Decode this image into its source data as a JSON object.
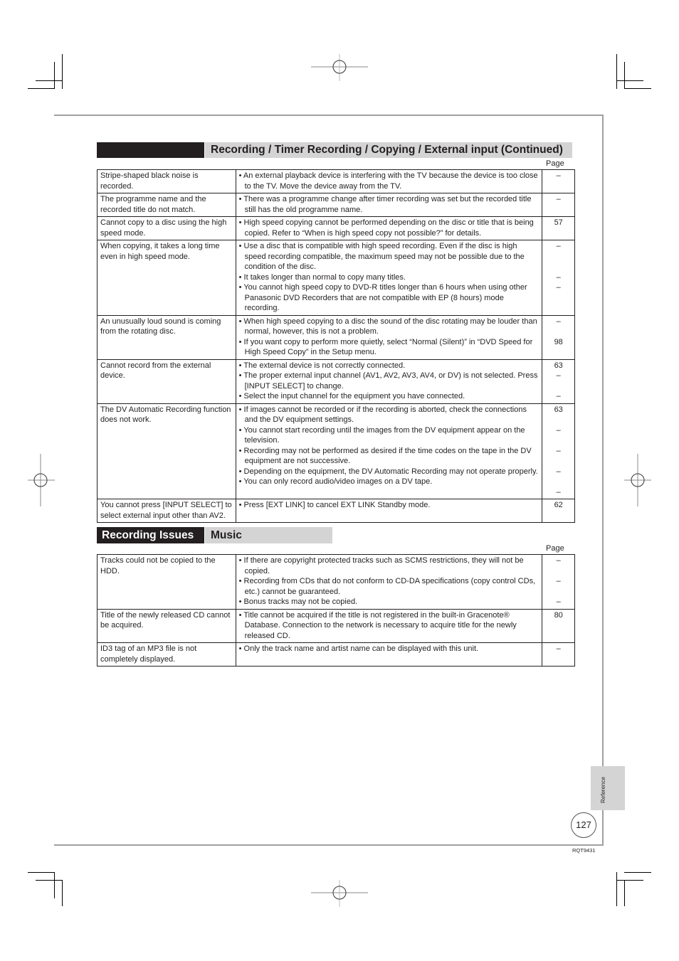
{
  "section1": {
    "title": "Recording / Timer Recording / Copying / External input (Continued)",
    "page_header": "Page",
    "rows": [
      {
        "symptom": "Stripe-shaped black noise is recorded.",
        "remedies": [
          {
            "text": "An external playback device is interfering with the TV because the device is too close to the TV. Move the device away from the TV.",
            "page": "–",
            "lines": 2
          }
        ]
      },
      {
        "symptom": "The programme name and the recorded title do not match.",
        "remedies": [
          {
            "text": "There was a programme change after timer recording was set but the recorded title still has the old programme name.",
            "page": "–",
            "lines": 2
          }
        ]
      },
      {
        "symptom": "Cannot copy to a disc using the high speed mode.",
        "remedies": [
          {
            "text": "High speed copying cannot be performed depending on the disc or title that is being copied. Refer to “When is high speed copy not possible?” for details.",
            "page": "57",
            "lines": 2
          }
        ]
      },
      {
        "symptom": "When copying, it takes a long time even in high speed mode.",
        "remedies": [
          {
            "text": "Use a disc that is compatible with high speed recording. Even if the disc is high speed recording compatible, the maximum speed may not be possible due to the condition of the disc.",
            "page": "–",
            "lines": 3
          },
          {
            "text": "It takes longer than normal to copy many titles.",
            "page": "–",
            "lines": 1
          },
          {
            "text": "You cannot high speed copy to DVD-R titles longer than 6 hours when using other Panasonic DVD Recorders that are not compatible with EP (8 hours) mode recording.",
            "page": "–",
            "lines": 3
          }
        ]
      },
      {
        "symptom": "An unusually loud sound is coming from the rotating disc.",
        "remedies": [
          {
            "text": "When high speed copying to a disc the sound of the disc rotating may be louder than normal, however, this is not a problem.",
            "page": "–",
            "lines": 2
          },
          {
            "text": "If you want copy to perform more quietly, select “Normal (Silent)” in “DVD Speed for High Speed Copy” in the Setup menu.",
            "page": "98",
            "lines": 2
          }
        ]
      },
      {
        "symptom": "Cannot record from the external device.",
        "remedies": [
          {
            "text": "The external device is not correctly connected.",
            "page": "63",
            "lines": 1
          },
          {
            "text": "The proper external input channel (AV1, AV2, AV3, AV4, or DV) is not selected. Press [INPUT SELECT] to change.",
            "page": "–",
            "lines": 2
          },
          {
            "text": "Select the input channel for the equipment you have connected.",
            "page": "–",
            "lines": 1
          }
        ]
      },
      {
        "symptom": "The DV Automatic Recording function does not work.",
        "remedies": [
          {
            "text": "If images cannot be recorded or if the recording is aborted, check the connections and the DV equipment settings.",
            "page": "63",
            "lines": 2
          },
          {
            "text": "You cannot start recording until the images from the DV equipment appear on the television.",
            "page": "–",
            "lines": 2
          },
          {
            "text": "Recording may not be performed as desired if the time codes on the tape in the DV equipment are not successive.",
            "page": "–",
            "lines": 2
          },
          {
            "text": "Depending on the equipment, the DV Automatic Recording may not operate properly.",
            "page": "–",
            "lines": 2
          },
          {
            "text": "You can only record audio/video images on a DV tape.",
            "page": "–",
            "lines": 1
          }
        ]
      },
      {
        "symptom": "You cannot press [INPUT SELECT] to select external input other than AV2.",
        "remedies": [
          {
            "text": "Press [EXT LINK] to cancel EXT LINK Standby mode.",
            "page": "62",
            "lines": 1
          }
        ]
      }
    ]
  },
  "section2": {
    "category": "Recording Issues",
    "title": "Music",
    "page_header": "Page",
    "rows": [
      {
        "symptom": "Tracks could not be copied to the HDD.",
        "remedies": [
          {
            "text": "If there are copyright protected tracks such as SCMS restrictions, they will not be copied.",
            "page": "–",
            "lines": 2
          },
          {
            "text": "Recording from CDs that do not conform to CD-DA specifications (copy control CDs, etc.) cannot be guaranteed.",
            "page": "–",
            "lines": 2
          },
          {
            "text": "Bonus tracks may not be copied.",
            "page": "–",
            "lines": 1
          }
        ]
      },
      {
        "symptom": "Title of the newly released CD cannot be acquired.",
        "remedies": [
          {
            "text": "Title cannot be acquired if the title is not registered in the built-in Gracenote® Database. Connection to the network is necessary to acquire title for the newly released CD.",
            "page": "80",
            "lines": 3
          }
        ]
      },
      {
        "symptom": "ID3 tag of an MP3 file is not completely displayed.",
        "remedies": [
          {
            "text": "Only the track name and artist name can be displayed with this unit.",
            "page": "–",
            "lines": 1
          }
        ]
      }
    ]
  },
  "sidebar_tab": "Reference",
  "page_number": "127",
  "document_code": "RQT9431"
}
